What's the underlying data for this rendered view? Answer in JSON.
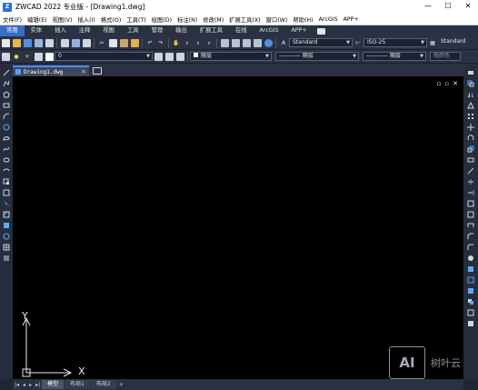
{
  "window": {
    "title": "ZWCAD 2022 专业版 - [Drawing1.dwg]",
    "logo_letter": "Z",
    "buttons": {
      "minimize": "—",
      "maximize": "☐",
      "close": "✕"
    }
  },
  "menu": [
    "文件(F)",
    "编辑(E)",
    "视图(V)",
    "插入(I)",
    "格式(O)",
    "工具(T)",
    "绘图(D)",
    "标注(N)",
    "修改(M)",
    "扩展工具(X)",
    "窗口(W)",
    "帮助(H)",
    "ArcGIS",
    "APP+"
  ],
  "ribbon_tabs": {
    "active": "常用",
    "items": [
      "常用",
      "实体",
      "插入",
      "注释",
      "视图",
      "工具",
      "管理",
      "输出",
      "扩展工具",
      "在线",
      "ArcGIS",
      "APP+"
    ]
  },
  "toolbar1": {
    "text_style": "Standard",
    "dim_style": "ISO-25",
    "table_style": "Standard"
  },
  "toolbar2": {
    "layer_value": "0",
    "color_value": "随层",
    "linetype_value": "———— 随层",
    "lineweight_value": "———— 随层",
    "plotstyle_value": "随颜色"
  },
  "document": {
    "tab_name": "Drawing1.dwg",
    "close_glyph": "×"
  },
  "canvas": {
    "controls": [
      "▫",
      "▫",
      "✕"
    ],
    "ucs": {
      "x_label": "X",
      "y_label": "Y"
    }
  },
  "layout_tabs": {
    "nav": [
      "|◂",
      "◂",
      "▸",
      "▸|"
    ],
    "items": [
      "模型",
      "布局1",
      "布局2"
    ],
    "active": "模型",
    "add": "+"
  },
  "watermark": {
    "logo_text": "AI",
    "text": "树叶云"
  },
  "colors": {
    "accent": "#3b6cc9",
    "canvas_bg": "#000000",
    "ui_bg": "#2b3244"
  }
}
